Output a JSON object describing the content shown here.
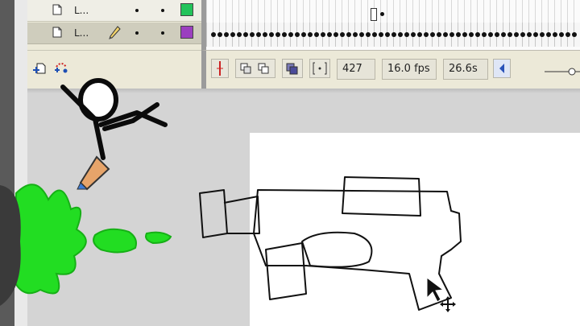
{
  "timeline": {
    "layers": [
      {
        "name": "L...",
        "color": "#22c35a",
        "active": false
      },
      {
        "name": "L...",
        "color": "#9b3fbf",
        "active": true
      }
    ],
    "controls": {
      "current_frame": "427",
      "frame_rate": "16.0 fps",
      "elapsed_time": "26.6s"
    }
  },
  "stage": {
    "background": "#ffffff",
    "ink_color": "#111111",
    "splash_color": "#22dd22"
  },
  "icons": [
    "add-layer-icon",
    "add-motion-guide-icon",
    "pencil-icon",
    "onion-skin-icon",
    "onion-outline-icon",
    "edit-multiple-frames-icon",
    "onion-markers-icon",
    "center-frame-icon",
    "scroll-left-icon",
    "move-cursor-icon"
  ]
}
